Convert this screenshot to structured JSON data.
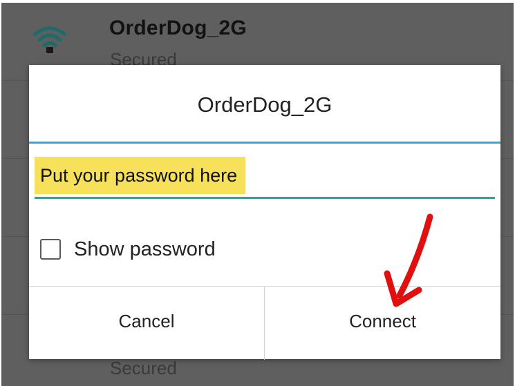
{
  "background_list": {
    "items": [
      {
        "name": "OrderDog_2G",
        "status": "Secured",
        "icon": "wifi-signal-icon"
      },
      {
        "name": "",
        "status": "",
        "icon": ""
      },
      {
        "name": "",
        "status": "",
        "icon": ""
      },
      {
        "name": "",
        "status": "",
        "icon": ""
      },
      {
        "name": "",
        "status": "Secured",
        "icon": "wifi-signal-icon"
      }
    ]
  },
  "dialog": {
    "title": "OrderDog_2G",
    "password_placeholder": "Put your password here",
    "show_password_label": "Show password",
    "show_password_checked": false,
    "cancel_label": "Cancel",
    "connect_label": "Connect"
  },
  "annotation": {
    "arrow_color": "#e01010",
    "arrow_target": "connect-button"
  },
  "colors": {
    "title_rule": "#37a7d6",
    "input_underline": "#2aa39a",
    "highlight": "#f8e15a",
    "scrim": "#5f5f5f"
  }
}
